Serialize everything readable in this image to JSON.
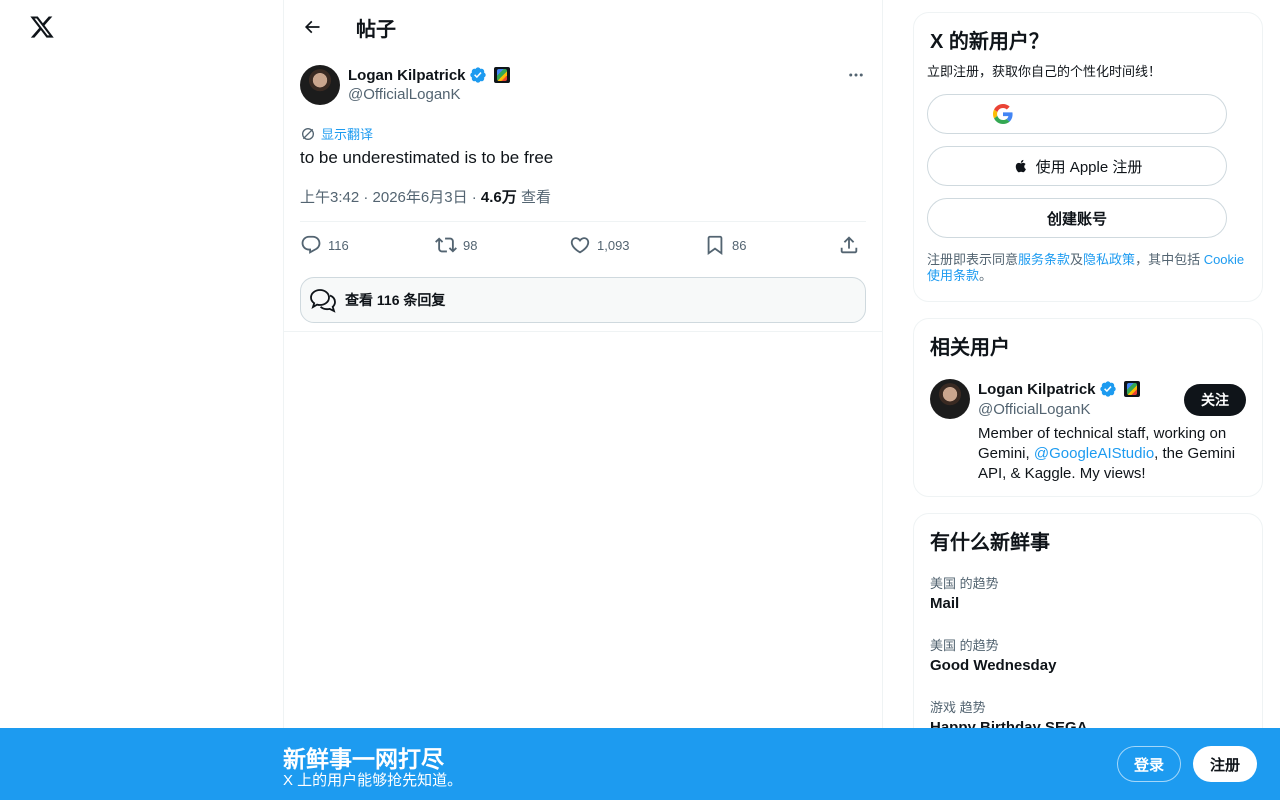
{
  "colors": {
    "accent": "#1d9bf0",
    "text": "#0f1419",
    "muted": "#536471"
  },
  "header": {
    "title": "帖子"
  },
  "post": {
    "author_name": "Logan Kilpatrick",
    "author_handle": "@OfficialLoganK",
    "translate_label": "显示翻译",
    "text": "to be underestimated is to be free",
    "time": "上午3:42 · 2026年6月3日 · ",
    "views_count": "4.6万",
    "views_label": " 查看",
    "replies": "116",
    "reposts": "98",
    "likes": "1,093",
    "bookmarks": "86",
    "view_replies_label": "查看 116 条回复"
  },
  "signup": {
    "title": "X 的新用户？",
    "subtitle": "立即注册，获取你自己的个性化时间线！",
    "apple_label": "使用 Apple 注册",
    "create_label": "创建账号",
    "terms_prefix": "注册即表示同意",
    "terms_link": "服务条款",
    "terms_and": "及",
    "privacy_link": "隐私政策",
    "terms_mid": "，其中包括 ",
    "cookie_link": "Cookie 使用条款",
    "terms_end": "。"
  },
  "related": {
    "title": "相关用户",
    "name": "Logan Kilpatrick",
    "handle": "@OfficialLoganK",
    "follow_label": "关注",
    "bio_1": "Member of technical staff, working on Gemini, ",
    "bio_link": "@GoogleAIStudio",
    "bio_2": ", the Gemini API, & Kaggle. My views!"
  },
  "trends": {
    "title": "有什么新鲜事",
    "items": [
      {
        "context": "美国 的趋势",
        "name": "Mail"
      },
      {
        "context": "美国 的趋势",
        "name": "Good Wednesday"
      },
      {
        "context": "游戏 趋势",
        "name": "Happy Birthday SEGA"
      }
    ]
  },
  "bottom_bar": {
    "title": "新鲜事一网打尽",
    "subtitle": "X 上的用户能够抢先知道。",
    "login_label": "登录",
    "signup_label": "注册"
  }
}
